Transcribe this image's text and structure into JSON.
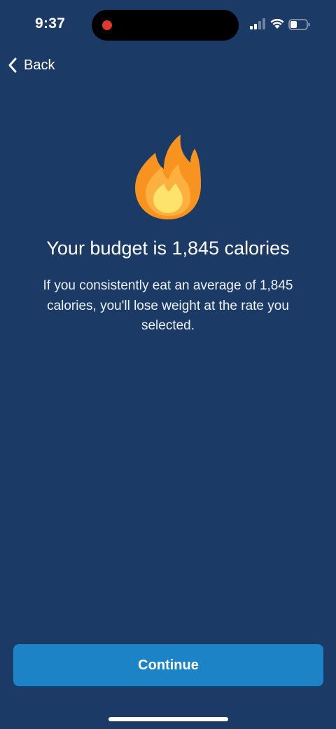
{
  "status_bar": {
    "time": "9:37",
    "signal_icon": "cellular-signal-icon",
    "wifi_icon": "wifi-icon",
    "battery_icon": "battery-icon",
    "recording_indicator_color": "#e0392b"
  },
  "nav": {
    "back_label": "Back",
    "back_icon": "chevron-left-icon"
  },
  "hero": {
    "icon": "flame-icon",
    "headline": "Your budget is 1,845 calories",
    "description": "If you consistently eat an average of 1,845 calories, you'll lose weight at the rate you selected."
  },
  "footer": {
    "continue_label": "Continue"
  },
  "colors": {
    "background": "#1c3a66",
    "accent_button": "#1c84c6",
    "flame_outer": "#f7931e",
    "flame_middle": "#fbb040",
    "flame_inner": "#fde26b"
  }
}
